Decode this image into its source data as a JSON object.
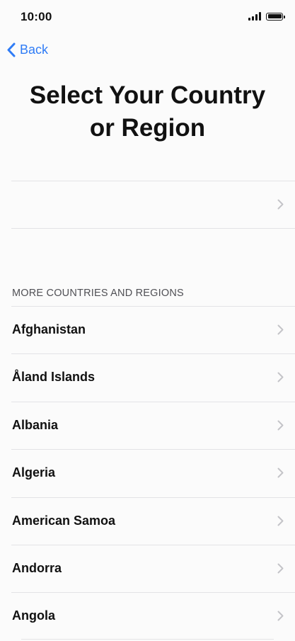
{
  "status_bar": {
    "time": "10:00"
  },
  "nav": {
    "back_label": "Back"
  },
  "page": {
    "title_line1": "Select Your Country",
    "title_line2": "or Region"
  },
  "section": {
    "header": "MORE COUNTRIES AND REGIONS"
  },
  "countries": [
    {
      "label": "Afghanistan"
    },
    {
      "label": "Åland Islands"
    },
    {
      "label": "Albania"
    },
    {
      "label": "Algeria"
    },
    {
      "label": "American Samoa"
    },
    {
      "label": "Andorra"
    },
    {
      "label": "Angola"
    }
  ],
  "icons": {
    "back": "chevron-left-icon",
    "row": "chevron-right-icon",
    "signal": "cellular-signal-icon",
    "battery": "battery-icon"
  },
  "colors": {
    "accent": "#2f7cf6",
    "background": "#fbfbfb",
    "text": "#111111",
    "secondary_text": "#505055",
    "separator": "#e3e3e6",
    "chevron": "#c4c4c8"
  }
}
